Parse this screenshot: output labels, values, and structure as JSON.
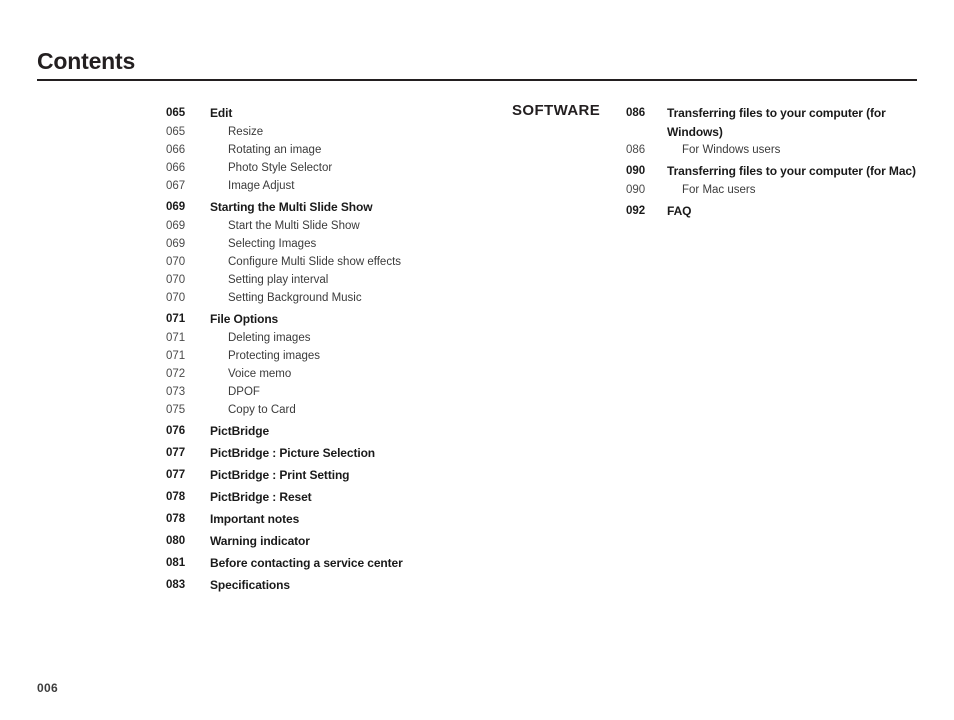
{
  "page": {
    "heading": "Contents",
    "folio": "006"
  },
  "columns": {
    "left": {
      "entries": [
        {
          "level": 1,
          "number": "065",
          "title": "Edit"
        },
        {
          "level": 2,
          "number": "065",
          "title": "Resize"
        },
        {
          "level": 2,
          "number": "066",
          "title": "Rotating an image"
        },
        {
          "level": 2,
          "number": "066",
          "title": "Photo Style Selector"
        },
        {
          "level": 2,
          "number": "067",
          "title": "Image Adjust"
        },
        {
          "level": 1,
          "number": "069",
          "title": "Starting the Multi Slide Show"
        },
        {
          "level": 2,
          "number": "069",
          "title": "Start the Multi Slide Show"
        },
        {
          "level": 2,
          "number": "069",
          "title": "Selecting Images"
        },
        {
          "level": 2,
          "number": "070",
          "title": "Configure Multi Slide show effects"
        },
        {
          "level": 2,
          "number": "070",
          "title": "Setting play interval"
        },
        {
          "level": 2,
          "number": "070",
          "title": "Setting Background Music"
        },
        {
          "level": 1,
          "number": "071",
          "title": "File Options"
        },
        {
          "level": 2,
          "number": "071",
          "title": "Deleting images"
        },
        {
          "level": 2,
          "number": "071",
          "title": "Protecting images"
        },
        {
          "level": 2,
          "number": "072",
          "title": "Voice memo"
        },
        {
          "level": 2,
          "number": "073",
          "title": "DPOF"
        },
        {
          "level": 2,
          "number": "075",
          "title": "Copy to Card"
        },
        {
          "level": 1,
          "number": "076",
          "title": "PictBridge"
        },
        {
          "level": 1,
          "number": "077",
          "title": "PictBridge : Picture Selection"
        },
        {
          "level": 1,
          "number": "077",
          "title": "PictBridge : Print Setting"
        },
        {
          "level": 1,
          "number": "078",
          "title": "PictBridge : Reset"
        },
        {
          "level": 1,
          "number": "078",
          "title": "Important notes"
        },
        {
          "level": 1,
          "number": "080",
          "title": "Warning indicator"
        },
        {
          "level": 1,
          "number": "081",
          "title": "Before contacting a service center"
        },
        {
          "level": 1,
          "number": "083",
          "title": "Specifications"
        }
      ]
    },
    "right": {
      "section_label": "SOFTWARE",
      "entries": [
        {
          "level": 1,
          "number": "086",
          "title": "Transferring files to your computer (for Windows)"
        },
        {
          "level": 2,
          "number": "086",
          "title": "For Windows users"
        },
        {
          "level": 1,
          "number": "090",
          "title": "Transferring files to your computer (for Mac)"
        },
        {
          "level": 2,
          "number": "090",
          "title": "For Mac users"
        },
        {
          "level": 1,
          "number": "092",
          "title": "FAQ"
        }
      ]
    }
  }
}
